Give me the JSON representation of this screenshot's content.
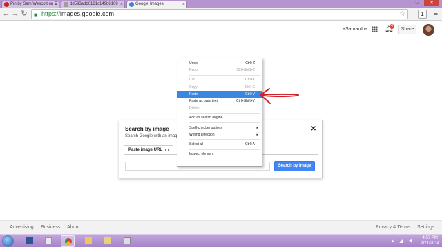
{
  "browser": {
    "tabs": [
      {
        "title": "Pin by Sam Wescott on E",
        "favicon_color": "#cb2027",
        "active": false
      },
      {
        "title": "dd593adb6181c149b8109",
        "favicon_color": "#9e9e9e",
        "active": false
      },
      {
        "title": "Google Images",
        "favicon_color": "#4a7fd6",
        "active": true
      }
    ],
    "url_scheme": "https://",
    "url_host": "images.google.com",
    "extension_label": "1"
  },
  "header": {
    "user": "+Samantha",
    "notification_count": "4",
    "share_label": "Share"
  },
  "search_by_image": {
    "title": "Search by image",
    "subtitle": "Search Google with an imag",
    "tab_label": "Paste image URL",
    "button_label": "Search by image"
  },
  "context_menu": {
    "items": [
      {
        "label": "Undo",
        "shortcut": "Ctrl+Z",
        "disabled": false
      },
      {
        "label": "Redo",
        "shortcut": "Ctrl+Shift+Z",
        "disabled": true
      },
      {
        "label": "Cut",
        "shortcut": "Ctrl+X",
        "disabled": true
      },
      {
        "label": "Copy",
        "shortcut": "Ctrl+C",
        "disabled": true
      },
      {
        "label": "Paste",
        "shortcut": "Ctrl+V",
        "disabled": false,
        "highlighted": true
      },
      {
        "label": "Paste as plain text",
        "shortcut": "Ctrl+Shift+V",
        "disabled": false
      },
      {
        "label": "Delete",
        "shortcut": "",
        "disabled": true
      },
      {
        "label": "Add as search engine...",
        "shortcut": "",
        "disabled": false
      },
      {
        "label": "Spell-checker options",
        "shortcut": "",
        "disabled": false,
        "submenu": true
      },
      {
        "label": "Writing Direction",
        "shortcut": "",
        "disabled": false,
        "submenu": true
      },
      {
        "label": "Select all",
        "shortcut": "Ctrl+A",
        "disabled": false
      },
      {
        "label": "Inspect element",
        "shortcut": "",
        "disabled": false
      }
    ],
    "highlight_color": "#3b87df"
  },
  "annotation": {
    "arrow_color": "#d0202a"
  },
  "footer": {
    "advertising": "Advertising",
    "business": "Business",
    "about": "About",
    "privacy_terms": "Privacy & Terms",
    "settings": "Settings"
  },
  "taskbar": {
    "time": "4:57 PM",
    "date": "9/21/2014"
  }
}
